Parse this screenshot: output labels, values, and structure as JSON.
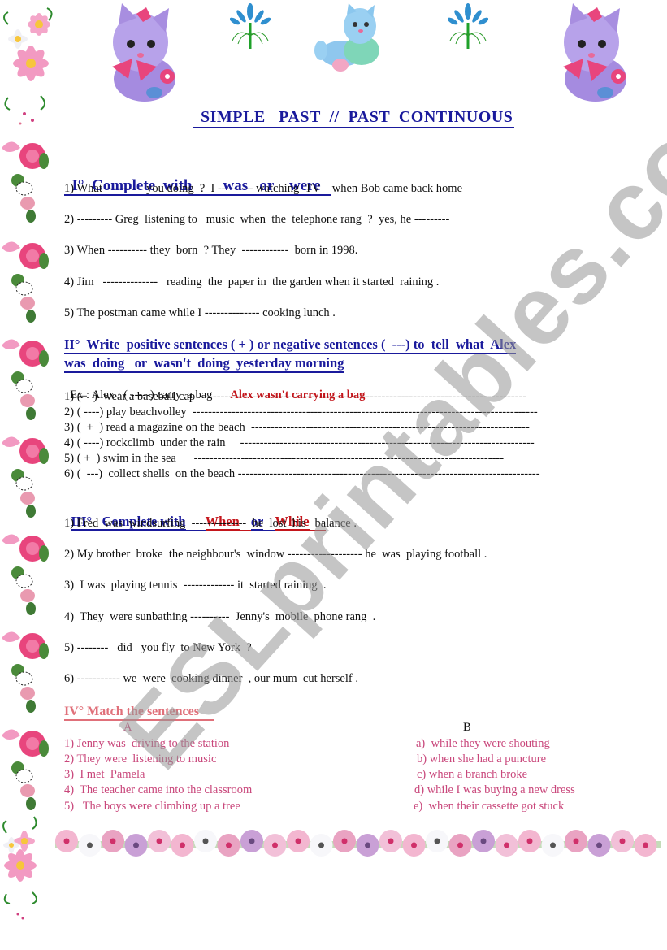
{
  "title": "SIMPLE   PAST  //  PAST  CONTINUOUS",
  "decorations": {
    "top": [
      "purple-kitten-icon",
      "blue-flower-icon",
      "blue-kitten-icon",
      "blue-flower-icon",
      "purple-kitten-icon"
    ],
    "left_border": [
      "pink-daisy-cluster-icon",
      "pink-rose-icon"
    ],
    "bottom": "flower-garland-icon"
  },
  "section1": {
    "heading_prefix": "I°  Complete  with",
    "heading_words": "was   or    were",
    "items": [
      "1) What ---------  you doing  ?  I --------- watching  TV    when Bob came back home",
      "2) --------- Greg  listening to   music  when  the  telephone rang  ?  yes, he ---------",
      "3) When ---------- they  born  ? They  ------------  born in 1998.",
      "4) Jim   --------------   reading  the  paper in  the garden when it started  raining .",
      "5) The postman came while I -------------- cooking lunch ."
    ]
  },
  "section2": {
    "heading_line1": "II°  Write  positive sentences ( + ) or negative sentences (  ---) to  tell  what  Alex",
    "heading_line2": "was  doing   or  wasn't  doing  yesterday morning",
    "example_prompt": "Ex : Alex : ( -----) carry  a bag",
    "example_answer": "Alex wasn't carrying a bag",
    "items": [
      "1) (+  )  wear a baseball cap  -----------------------------------------------------------------------------------",
      "2) ( ----) play beachvolley  ----------------------------------------------------------------------------------------",
      "3) (  +  ) read a magazine on the beach  -----------------------------------------------------------------------",
      "4) ( ----) rockclimb  under the rain     ---------------------------------------------------------------------------",
      "5) ( +  ) swim in the sea      -------------------------------------------------------------------------------",
      "6) (  ---)  collect shells  on the beach -----------------------------------------------------------------------------"
    ]
  },
  "section3": {
    "heading_prefix": "III°   Complete with",
    "heading_word1": "When",
    "heading_or": "or",
    "heading_word2": "While",
    "items": [
      "1) Fred  was  windsurfing  --------------  he  lost  his   balance .",
      "2) My brother  broke  the neighbour's  window ------------------- he  was  playing football .",
      "3)  I was  playing tennis  ------------- it  started raining  .",
      "4)  They  were sunbathing ----------  Jenny's  mobile  phone rang  .",
      "5) --------   did   you fly  to New York  ?",
      "6) ----------- we  were  cooking dinner  , our mum  cut herself ."
    ]
  },
  "section4": {
    "heading": "IV° Match the sentences",
    "column_a_label": "A",
    "column_b_label": "B",
    "column_a": [
      "1) Jenny was  driving to the station",
      "2) They were  listening to music",
      "3)  I met  Pamela",
      "4)  The teacher came into the classroom",
      "5)   The boys were climbing up a tree"
    ],
    "column_b": [
      "a)  while they were shouting",
      "b) when she had a puncture",
      "c) when a branch broke",
      "d) while I was buying a new dress",
      "e)  when their cassette got stuck"
    ]
  },
  "watermark": "ESLprintables.com",
  "colors": {
    "heading_blue": "#1a1a9c",
    "accent_red": "#c4161c",
    "match_pink": "#c9477b"
  }
}
